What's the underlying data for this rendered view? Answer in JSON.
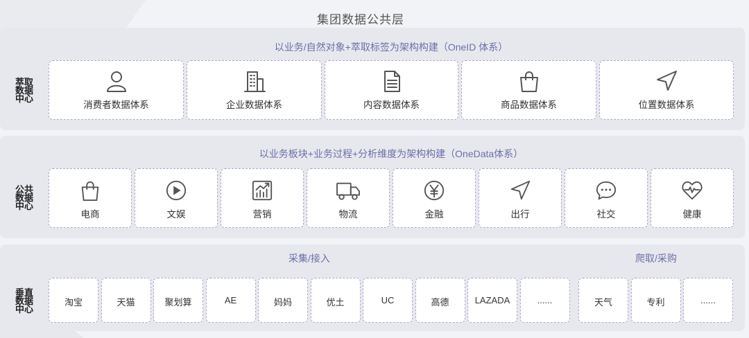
{
  "title": "集团数据公共层",
  "extract_layer": {
    "label": [
      "萃取",
      "数据",
      "中心"
    ],
    "subtitle": "以业务/自然对象+萃取标签为架构构建（OneID 体系）",
    "items": [
      {
        "label": "消费者数据体系",
        "icon": "user-icon"
      },
      {
        "label": "企业数据体系",
        "icon": "building-icon"
      },
      {
        "label": "内容数据体系",
        "icon": "document-icon"
      },
      {
        "label": "商品数据体系",
        "icon": "shopping-bag-icon"
      },
      {
        "label": "位置数据体系",
        "icon": "navigation-icon"
      }
    ]
  },
  "public_layer": {
    "label": [
      "公共",
      "数据",
      "中心"
    ],
    "subtitle": "以业务板块+业务过程+分析维度为架构构建（OneData体系）",
    "items": [
      {
        "label": "电商",
        "icon": "shopping-bag-icon"
      },
      {
        "label": "文娱",
        "icon": "play-icon"
      },
      {
        "label": "营销",
        "icon": "chart-icon"
      },
      {
        "label": "物流",
        "icon": "truck-icon"
      },
      {
        "label": "金融",
        "icon": "yen-icon"
      },
      {
        "label": "出行",
        "icon": "navigation-icon"
      },
      {
        "label": "社交",
        "icon": "chat-icon"
      },
      {
        "label": "健康",
        "icon": "heart-pulse-icon"
      }
    ]
  },
  "vertical_layer": {
    "label": [
      "垂直",
      "数据",
      "中心"
    ],
    "collect_title": "采集/接入",
    "crawl_title": "爬取/采购",
    "collect_items": [
      "淘宝",
      "天猫",
      "聚划算",
      "AE",
      "妈妈",
      "优土",
      "UC",
      "高德",
      "LAZADA",
      "......"
    ],
    "crawl_items": [
      "天气",
      "专利",
      "......"
    ]
  }
}
